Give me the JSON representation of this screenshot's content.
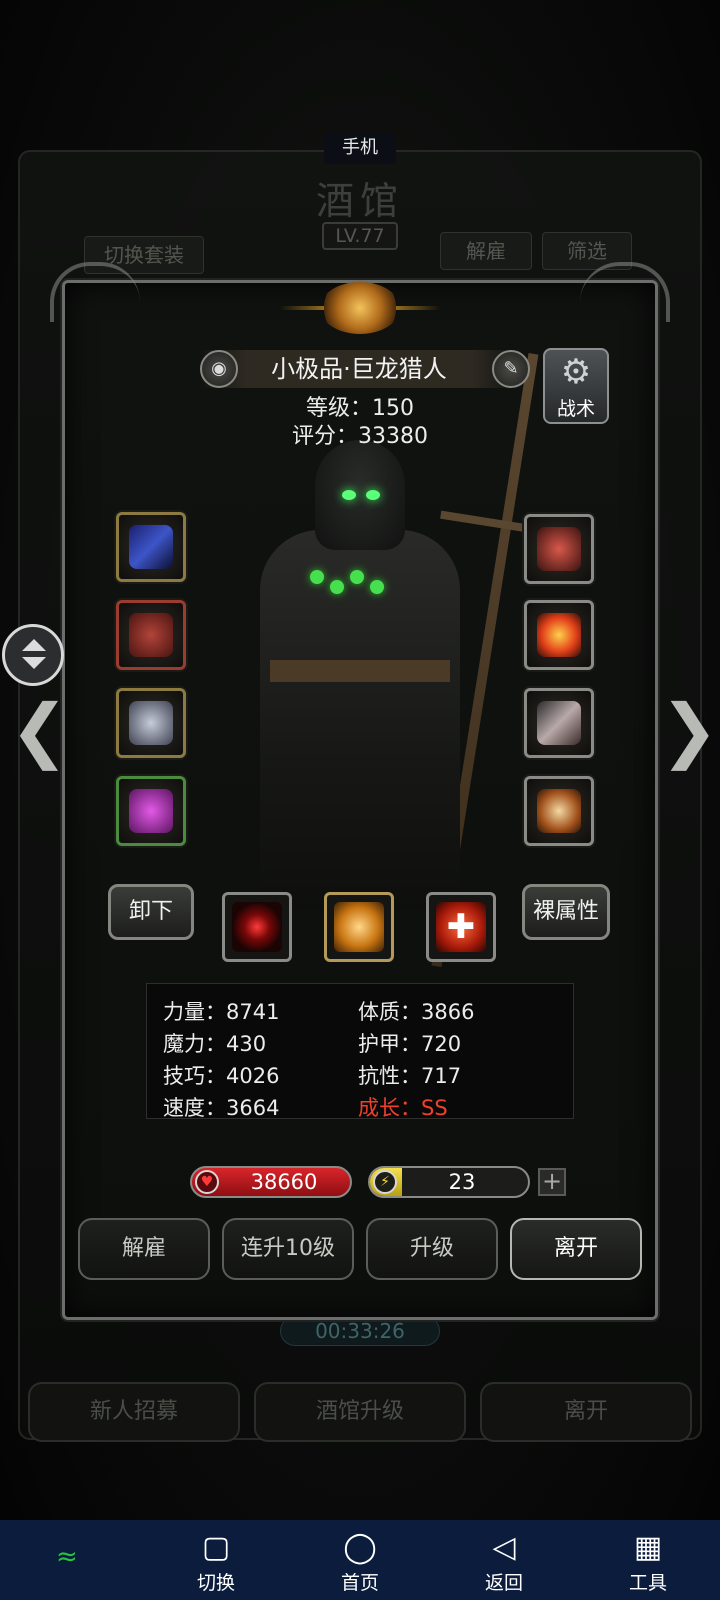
{
  "top_label": "手机",
  "background": {
    "title": "酒馆",
    "level": "LV.77",
    "switch_set_btn": "切换套装",
    "dismiss_btn": "解雇",
    "filter_btn": "筛选",
    "timer": "00:33:26",
    "bottom_buttons": [
      "新人招募",
      "酒馆升级",
      "离开"
    ]
  },
  "hero": {
    "name": "小极品·巨龙猎人",
    "level_text": "等级：150",
    "score_text": "评分：33380",
    "tactics_label": "战术"
  },
  "buttons": {
    "unequip": "卸下",
    "bare_attr": "裸属性"
  },
  "stats": [
    {
      "label": "力量：8741"
    },
    {
      "label": "体质：3866"
    },
    {
      "label": "魔力：430"
    },
    {
      "label": "护甲：720"
    },
    {
      "label": "技巧：4026"
    },
    {
      "label": "抗性：717"
    },
    {
      "label": "速度：3664"
    },
    {
      "label": "成长：SS",
      "highlight": true
    }
  ],
  "hp": {
    "value": "38660",
    "icon": "heart-icon"
  },
  "energy": {
    "value": "23",
    "fill_fraction": 0.2,
    "icon": "lightning-icon"
  },
  "plus_label": "+",
  "actions": [
    "解雇",
    "连升10级",
    "升级",
    "离开"
  ],
  "sysnav": [
    {
      "label": "切换",
      "icon": "square-icon"
    },
    {
      "label": "首页",
      "icon": "circle-icon"
    },
    {
      "label": "返回",
      "icon": "triangle-back-icon"
    },
    {
      "label": "工具",
      "icon": "grid-icon"
    }
  ],
  "colors": {
    "accent_red": "#f0402c",
    "hp_red": "#d8252a",
    "energy_yellow": "#f5e04a",
    "eye_green": "#5cff7a",
    "nav_bg": "#0b1c3c"
  }
}
